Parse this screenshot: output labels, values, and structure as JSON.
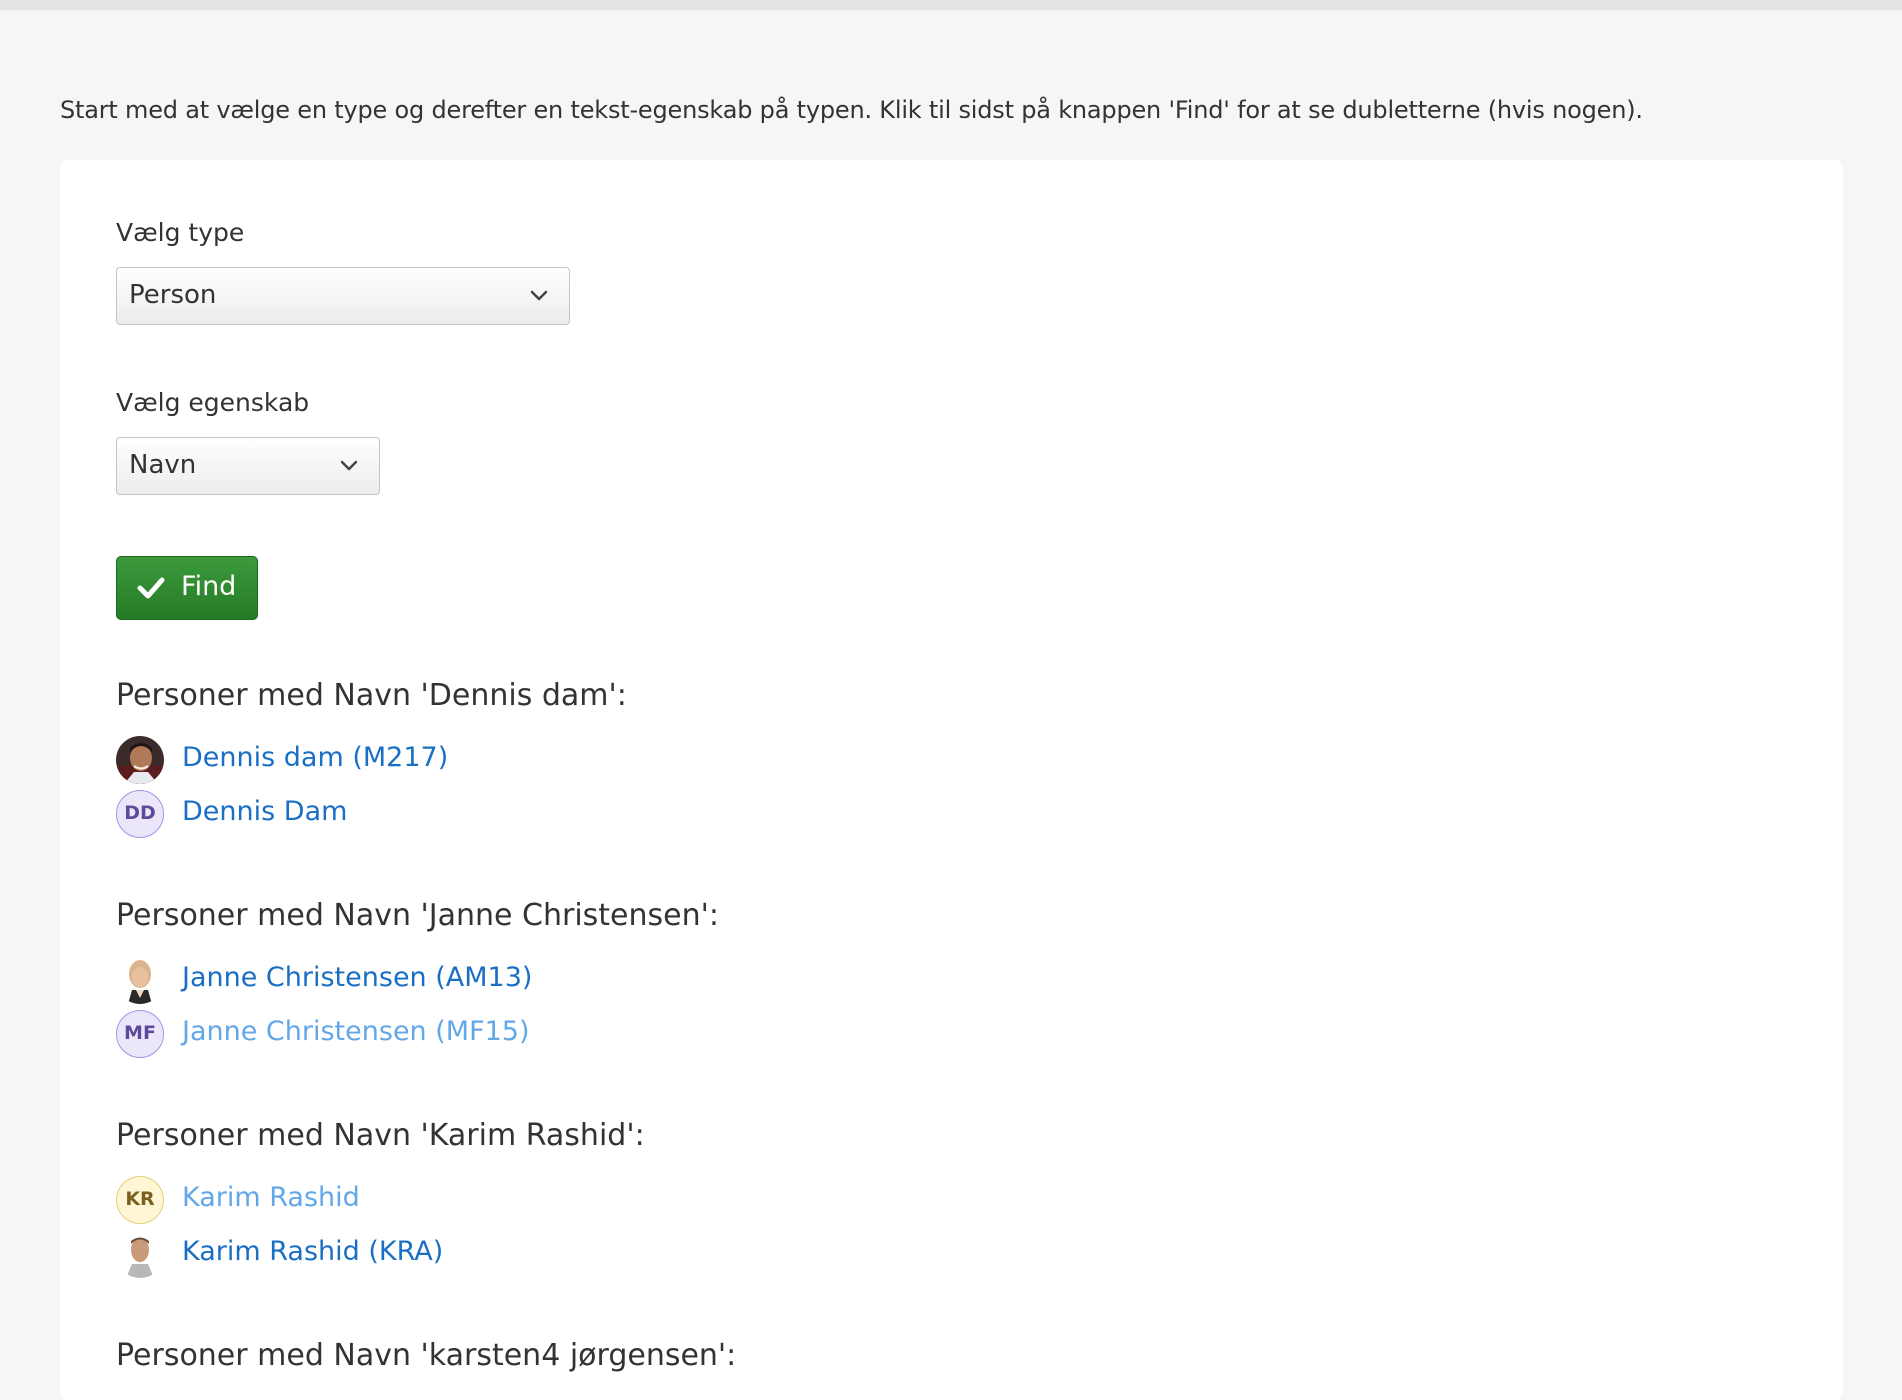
{
  "intro_text": "Start med at vælge en type og derefter en tekst-egenskab på typen. Klik til sidst på knappen 'Find' for at se dubletterne (hvis nogen).",
  "type_field": {
    "label": "Vælg type",
    "value": "Person"
  },
  "property_field": {
    "label": "Vælg egenskab",
    "value": "Navn"
  },
  "find_button": {
    "label": "Find",
    "icon": "check-icon",
    "color": "#2e8b2e"
  },
  "groups": [
    {
      "title": "Personer med Navn 'Dennis dam':",
      "people": [
        {
          "name": "Dennis dam (M217)",
          "avatar": "photo",
          "style": "dark"
        },
        {
          "name": "Dennis Dam",
          "avatar": "initials",
          "initials": "DD",
          "style": "dark"
        }
      ]
    },
    {
      "title": "Personer med Navn 'Janne Christensen':",
      "people": [
        {
          "name": "Janne Christensen (AM13)",
          "avatar": "photo",
          "style": "dark"
        },
        {
          "name": "Janne Christensen (MF15)",
          "avatar": "initials",
          "initials": "MF",
          "style": "light"
        }
      ]
    },
    {
      "title": "Personer med Navn 'Karim Rashid':",
      "people": [
        {
          "name": "Karim Rashid",
          "avatar": "initials",
          "initials": "KR",
          "style": "light"
        },
        {
          "name": "Karim Rashid (KRA)",
          "avatar": "photo",
          "style": "dark"
        }
      ]
    },
    {
      "title": "Personer med Navn 'karsten4 jørgensen':",
      "people": []
    }
  ],
  "colors": {
    "link_dark": "#1a6fc4",
    "link_light": "#62a7e8",
    "page_bg": "#f6f6f6",
    "card_bg": "#ffffff"
  }
}
